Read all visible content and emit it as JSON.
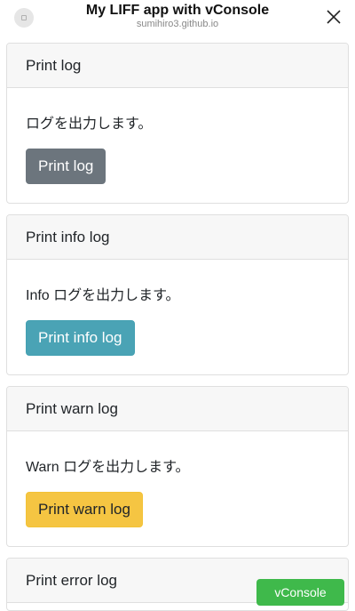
{
  "header": {
    "title": "My LIFF app with vConsole",
    "subtitle": "sumihiro3.github.io"
  },
  "cards": [
    {
      "header": "Print log",
      "text": "ログを出力します。",
      "button": "Print log"
    },
    {
      "header": "Print info log",
      "text": "Info ログを出力します。",
      "button": "Print info log"
    },
    {
      "header": "Print warn log",
      "text": "Warn ログを出力します。",
      "button": "Print warn log"
    },
    {
      "header": "Print error log"
    }
  ],
  "vconsole": {
    "label": "vConsole"
  },
  "colors": {
    "secondary": "#6c757d",
    "info": "#4aa3b5",
    "warning": "#f5c542",
    "vconsole": "#3fb94b"
  }
}
